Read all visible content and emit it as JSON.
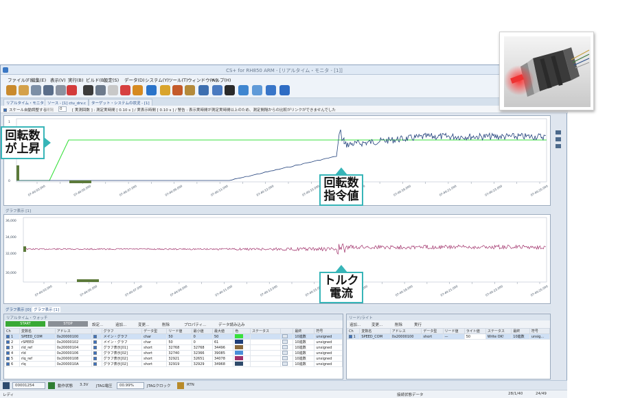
{
  "window": {
    "title": "CS+ for RH850 ARM - [リアルタイム・モニタ - [1]]"
  },
  "menu": [
    "ファイル(F)",
    "編集(E)",
    "表示(V)",
    "実行(B)",
    "ビルド(B)",
    "設定(S)",
    "データ(D)",
    "システム(Y)",
    "ツール(T)",
    "ウィンドウ(W)",
    "ヘルプ(H)"
  ],
  "tabs": [
    "リアルタイム・モニタ - [1]",
    "ソース - [1] ctu_drv.c",
    "ターゲット・システムの状況 - [1]"
  ],
  "status_row": {
    "checkbox_label": "スケール自動調整する",
    "interval_label": "間隔",
    "interval_value": "0",
    "message": "[ 実測回数 ] : 測定実時間 [ 0.10 s ] / 実表示時間 [ 0.10 s ] / 警告 : 表示実時間が測定実時間以上のため、測定間隔からの比較がリンクができませんでした"
  },
  "upper_graph": {
    "caption": "グラフ表示 [0]",
    "y_min_label": "0",
    "y_max_label": "1",
    "time_ticks": [
      "07:40:03.000",
      "07:40:04.000",
      "07:40:05.000",
      "07:40:06.000",
      "07:40:07.000",
      "07:40:08.000",
      "07:40:09.000",
      "07:40:10.000",
      "07:40:11.000",
      "07:40:12.000",
      "07:40:13.000",
      "07:40:14.000",
      "07:40:15.000",
      "07:40:16.000",
      "07:40:17.000",
      "07:40:18.000",
      "07:40:19.000",
      "07:40:20.000",
      "07:40:21.000",
      "07:40:22.000",
      "07:40:23.000",
      "07:40:24.000",
      "07:40:25.000"
    ]
  },
  "lower_graph": {
    "caption": "グラフ表示 [1]",
    "y_labels": [
      "36,000",
      "34,000",
      "32,000",
      "30,000"
    ],
    "time_ticks": [
      "07:40:03.000",
      "07:40:04.000",
      "07:40:05.000",
      "07:40:06.000",
      "07:40:07.000",
      "07:40:08.000",
      "07:40:09.000",
      "07:40:10.000",
      "07:40:11.000",
      "07:40:12.000",
      "07:40:13.000",
      "07:40:14.000",
      "07:40:15.000",
      "07:40:16.000",
      "07:40:17.000",
      "07:40:18.000",
      "07:40:19.000",
      "07:40:20.000",
      "07:40:21.000",
      "07:40:22.000",
      "07:40:23.000",
      "07:40:24.000",
      "07:40:25.000"
    ]
  },
  "bottom_tabs": [
    "グラフ表示 [0]",
    "グラフ表示 [1]"
  ],
  "monitor_panel": {
    "caption": "リアルタイム・ウォッチ",
    "start_label": "START",
    "stop_label": "STOP",
    "actions": [
      "設定...",
      "追加...",
      "変更...",
      "削除",
      "プロパティ...",
      "データ読み込み"
    ],
    "columns": [
      "Ch",
      "変数名",
      "アドレス",
      "",
      "グラフ",
      "データ型",
      "リード値",
      "最小値",
      "最大値",
      "色",
      "ステータス",
      "",
      "最終",
      "符号"
    ],
    "rows": [
      {
        "ch": "1",
        "name": "SPEED_COM",
        "addr": "0x20000100",
        "graph": "メイン・グラフ",
        "type": "char",
        "read": "50",
        "min": "0",
        "max": "50",
        "color": "#38e03c",
        "status": "10進数",
        "sign": "unsigned"
      },
      {
        "ch": "2",
        "name": "rSPEED",
        "addr": "0x20000102",
        "graph": "メイン・グラフ",
        "type": "char",
        "read": "50",
        "min": "0",
        "max": "61",
        "color": "#1f3f7a",
        "status": "10進数",
        "sign": "unsigned"
      },
      {
        "ch": "3",
        "name": "rId_ref",
        "addr": "0x20000104",
        "graph": "グラフ表示[01]",
        "type": "short",
        "read": "32768",
        "min": "32768",
        "max": "34496",
        "color": "#8a6a3c",
        "status": "10進数",
        "sign": "unsigned"
      },
      {
        "ch": "4",
        "name": "rId",
        "addr": "0x20000106",
        "graph": "グラフ表示[02]",
        "type": "short",
        "read": "32740",
        "min": "32366",
        "max": "39085",
        "color": "#4a8fd8",
        "status": "10進数",
        "sign": "unsigned"
      },
      {
        "ch": "5",
        "name": "rIq_ref",
        "addr": "0x20000108",
        "graph": "グラフ表示[02]",
        "type": "short",
        "read": "32921",
        "min": "32651",
        "max": "34078",
        "color": "#a0306a",
        "status": "10進数",
        "sign": "unsigned"
      },
      {
        "ch": "6",
        "name": "rIq",
        "addr": "0x2000010A",
        "graph": "グラフ表示[02]",
        "type": "short",
        "read": "32919",
        "min": "32929",
        "max": "34968",
        "color": "#2e4a6a",
        "status": "10進数",
        "sign": "unsigned"
      }
    ]
  },
  "write_panel": {
    "caption": "リード/ライト",
    "actions": [
      "追加...",
      "変更...",
      "削除",
      "実行"
    ],
    "columns": [
      "Ch",
      "変数名",
      "アドレス",
      "データ型",
      "リード値",
      "ライト値",
      "ステータス",
      "最終",
      "符号"
    ],
    "row": {
      "ch": "1",
      "name": "SPEED_COM",
      "addr": "0x20000100",
      "type": "short",
      "read": "—",
      "write": "50",
      "status": "Write OK!",
      "fmt": "10進数",
      "sign": "unsig..."
    }
  },
  "footer": {
    "value_box": "00001254",
    "state_label": "動作状態",
    "voltage": "3.3V",
    "jtag_label": "JTAG電圧",
    "percent": "00.99%",
    "clock_label": "JTAGクロック",
    "rtn_label": "RTN"
  },
  "bottom_status": {
    "left": "レディ",
    "center": "接続状態データ",
    "right_1": "28/1/40",
    "right_2": "24/49"
  },
  "callouts": {
    "speed_rise": [
      "回転数",
      "が上昇"
    ],
    "speed_command": [
      "回転数",
      "指令値"
    ],
    "torque_current": [
      "トルク",
      "電流"
    ]
  },
  "colors": {
    "accent": "#37b5b8",
    "command_line": "#38e03c",
    "speed_line": "#1f3f7a",
    "current_line": "#a0306a"
  }
}
